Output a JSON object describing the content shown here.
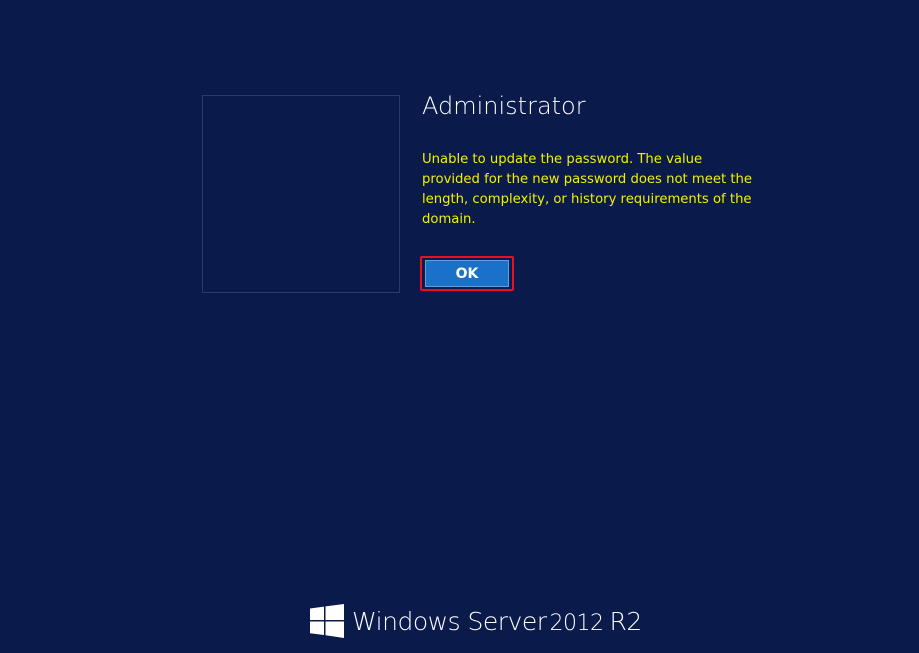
{
  "user": {
    "name": "Administrator"
  },
  "dialog": {
    "message": "Unable to update the password. The value provided for the new password does not meet the length, complexity, or history requirements of the domain.",
    "ok_label": "OK"
  },
  "branding": {
    "name": "Windows Server",
    "version": "2012",
    "edition": "R2",
    "logo_icon": "windows-logo-icon"
  },
  "colors": {
    "background": "#0a1a4a",
    "message_text": "#f1f100",
    "button": "#1a72c8",
    "focus_outline": "#e81123"
  }
}
